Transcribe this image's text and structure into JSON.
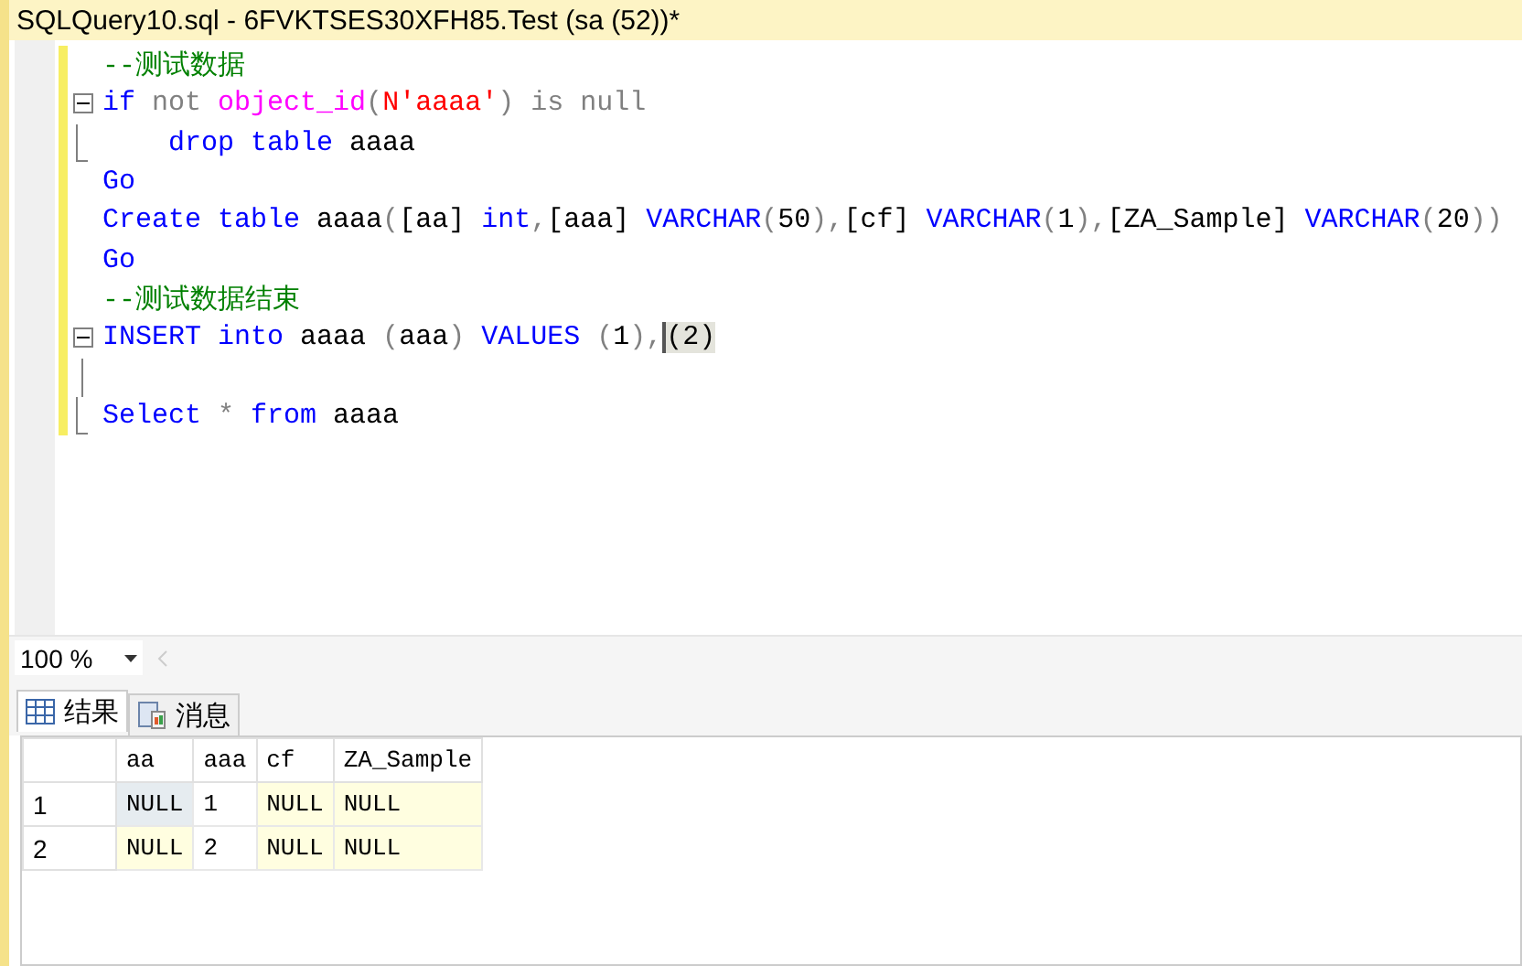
{
  "window": {
    "title": "SQLQuery10.sql - 6FVKTSES30XFH85.Test (sa (52))*"
  },
  "editor": {
    "lines": [
      {
        "kind": "plain",
        "tokens": [
          {
            "kind": "comment",
            "text": "--测试数据"
          }
        ]
      },
      {
        "kind": "fold",
        "tokens": [
          {
            "kind": "keyword",
            "text": "if"
          },
          {
            "kind": "gray",
            "text": " not "
          },
          {
            "kind": "func",
            "text": "object_id"
          },
          {
            "kind": "gray",
            "text": "("
          },
          {
            "kind": "string",
            "text": "N'aaaa'"
          },
          {
            "kind": "gray",
            "text": ") is null"
          }
        ]
      },
      {
        "kind": "foldend",
        "tokens": [
          {
            "kind": "keyword",
            "text": "    drop table"
          },
          {
            "kind": "plain",
            "text": " aaaa"
          }
        ]
      },
      {
        "kind": "plain",
        "tokens": [
          {
            "kind": "keyword",
            "text": "Go"
          }
        ]
      },
      {
        "kind": "plain",
        "tokens": [
          {
            "kind": "keyword",
            "text": "Create table"
          },
          {
            "kind": "plain",
            "text": " aaaa"
          },
          {
            "kind": "gray",
            "text": "("
          },
          {
            "kind": "plain",
            "text": "[aa] "
          },
          {
            "kind": "keyword",
            "text": "int"
          },
          {
            "kind": "gray",
            "text": ","
          },
          {
            "kind": "plain",
            "text": "[aaa] "
          },
          {
            "kind": "keyword",
            "text": "VARCHAR"
          },
          {
            "kind": "gray",
            "text": "("
          },
          {
            "kind": "plain",
            "text": "50"
          },
          {
            "kind": "gray",
            "text": "),"
          },
          {
            "kind": "plain",
            "text": "[cf] "
          },
          {
            "kind": "keyword",
            "text": "VARCHAR"
          },
          {
            "kind": "gray",
            "text": "("
          },
          {
            "kind": "plain",
            "text": "1"
          },
          {
            "kind": "gray",
            "text": "),"
          },
          {
            "kind": "plain",
            "text": "[ZA_Sample] "
          },
          {
            "kind": "keyword",
            "text": "VARCHAR"
          },
          {
            "kind": "gray",
            "text": "("
          },
          {
            "kind": "plain",
            "text": "20"
          },
          {
            "kind": "gray",
            "text": "))"
          }
        ]
      },
      {
        "kind": "plain",
        "tokens": [
          {
            "kind": "keyword",
            "text": "Go"
          }
        ]
      },
      {
        "kind": "plain",
        "tokens": [
          {
            "kind": "comment",
            "text": "--测试数据结束"
          }
        ]
      },
      {
        "kind": "fold",
        "tokens": [
          {
            "kind": "keyword",
            "text": "INSERT into"
          },
          {
            "kind": "plain",
            "text": " aaaa "
          },
          {
            "kind": "gray",
            "text": "("
          },
          {
            "kind": "plain",
            "text": "aaa"
          },
          {
            "kind": "gray",
            "text": ") "
          },
          {
            "kind": "keyword",
            "text": "VALUES"
          },
          {
            "kind": "gray",
            "text": " ("
          },
          {
            "kind": "plain",
            "text": "1"
          },
          {
            "kind": "gray",
            "text": "),"
          },
          {
            "kind": "match",
            "text": "(2)"
          }
        ]
      },
      {
        "kind": "foldline"
      },
      {
        "kind": "foldend",
        "tokens": [
          {
            "kind": "keyword",
            "text": "Select"
          },
          {
            "kind": "gray",
            "text": " * "
          },
          {
            "kind": "keyword",
            "text": "from"
          },
          {
            "kind": "plain",
            "text": " aaaa"
          }
        ]
      }
    ]
  },
  "zoom": {
    "value": "100 %"
  },
  "results_tabs": [
    {
      "label": "结果",
      "kind": "grid",
      "selected": true
    },
    {
      "label": "消息",
      "kind": "messages",
      "selected": false
    }
  ],
  "grid": {
    "columns": [
      "aa",
      "aaa",
      "cf",
      "ZA_Sample"
    ],
    "rows": [
      {
        "number": "1",
        "cells": [
          {
            "text": "NULL",
            "is_null": true,
            "selected": true
          },
          {
            "text": "1",
            "is_null": false,
            "selected": false
          },
          {
            "text": "NULL",
            "is_null": true,
            "selected": false
          },
          {
            "text": "NULL",
            "is_null": true,
            "selected": false
          }
        ]
      },
      {
        "number": "2",
        "cells": [
          {
            "text": "NULL",
            "is_null": true,
            "selected": false
          },
          {
            "text": "2",
            "is_null": false,
            "selected": false
          },
          {
            "text": "NULL",
            "is_null": true,
            "selected": false
          },
          {
            "text": "NULL",
            "is_null": true,
            "selected": false
          }
        ]
      }
    ]
  }
}
